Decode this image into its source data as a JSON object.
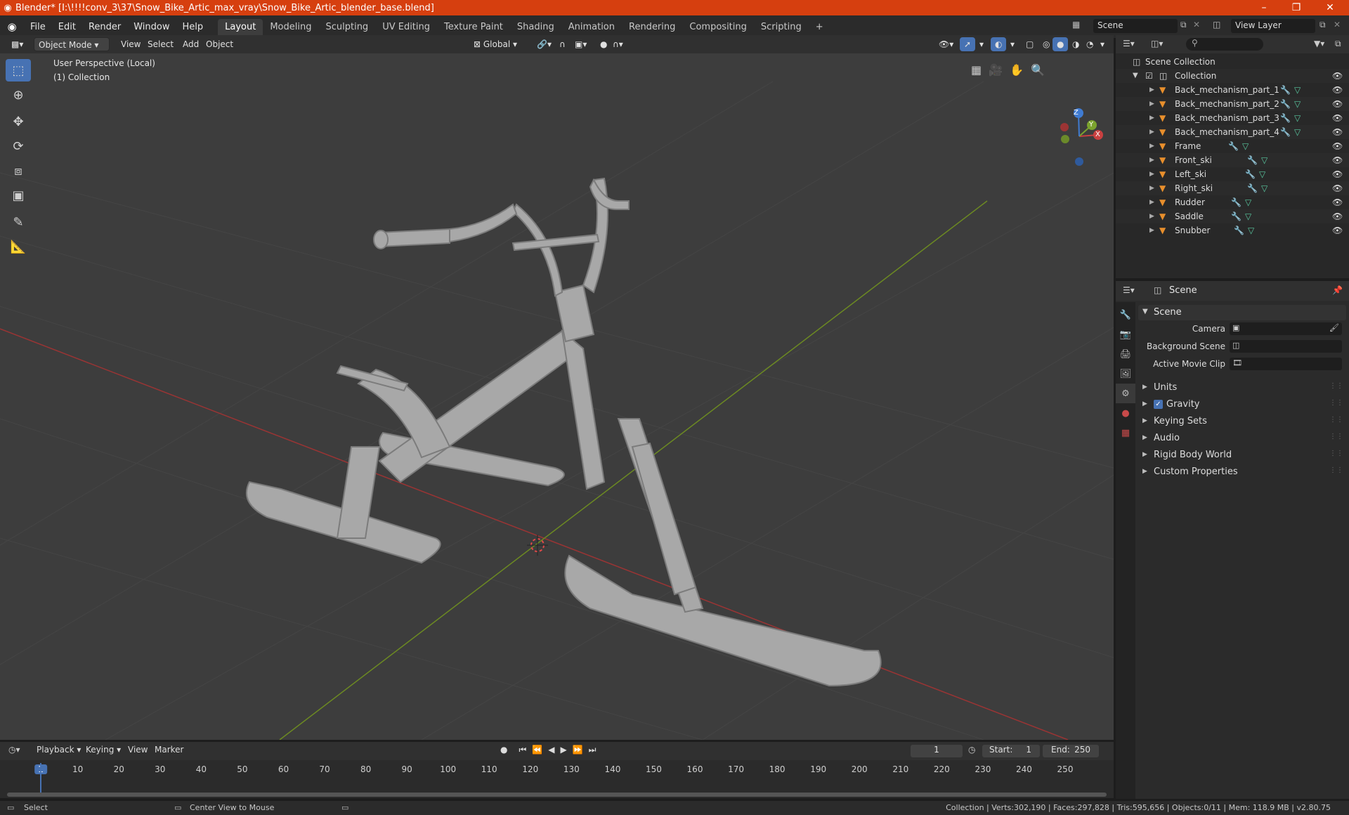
{
  "window": {
    "title": "Blender* [I:\\!!!!conv_3\\37\\Snow_Bike_Artic_max_vray\\Snow_Bike_Artic_blender_base.blend]",
    "minimize": "–",
    "restore": "❐",
    "close": "✕"
  },
  "menu": [
    "File",
    "Edit",
    "Render",
    "Window",
    "Help"
  ],
  "workspaces": [
    "Layout",
    "Modeling",
    "Sculpting",
    "UV Editing",
    "Texture Paint",
    "Shading",
    "Animation",
    "Rendering",
    "Compositing",
    "Scripting"
  ],
  "active_workspace": "Layout",
  "add_workspace": "+",
  "scene_field": "Scene",
  "view_layer_field": "View Layer",
  "viewport_header": {
    "mode": "Object Mode",
    "menus": [
      "View",
      "Select",
      "Add",
      "Object"
    ],
    "orientation": "Global"
  },
  "viewport": {
    "perspective": "User Perspective (Local)",
    "collection": "(1) Collection",
    "gizmo": {
      "x": "X",
      "y": "Y",
      "z": "Z"
    }
  },
  "outliner": {
    "search_placeholder": "",
    "root": "Scene Collection",
    "collection": "Collection",
    "objects": [
      "Back_mechanism_part_1",
      "Back_mechanism_part_2",
      "Back_mechanism_part_3",
      "Back_mechanism_part_4",
      "Frame",
      "Front_ski",
      "Left_ski",
      "Right_ski",
      "Rudder",
      "Saddle",
      "Snubber"
    ]
  },
  "properties": {
    "context": "Scene",
    "panel_title": "Scene",
    "camera_label": "Camera",
    "background_scene_label": "Background Scene",
    "active_movie_clip_label": "Active Movie Clip",
    "subpanels": [
      "Units",
      "Gravity",
      "Keying Sets",
      "Audio",
      "Rigid Body World",
      "Custom Properties"
    ],
    "gravity_checked": true
  },
  "timeline": {
    "menus": [
      "Playback",
      "Keying",
      "View",
      "Marker"
    ],
    "current_frame": "1",
    "start_label": "Start:",
    "start": "1",
    "end_label": "End:",
    "end": "250",
    "ticks": [
      "1",
      "10",
      "20",
      "30",
      "40",
      "50",
      "60",
      "70",
      "80",
      "90",
      "100",
      "110",
      "120",
      "130",
      "140",
      "150",
      "160",
      "170",
      "180",
      "190",
      "200",
      "210",
      "220",
      "230",
      "240",
      "250"
    ]
  },
  "statusbar": {
    "left": "Select",
    "middle": "Center View to Mouse",
    "right": "Collection | Verts:302,190 | Faces:297,828 | Tris:595,656 | Objects:0/11 | Mem: 118.9 MB | v2.80.75"
  },
  "colors": {
    "titlebar": "#d63f0f",
    "accent": "#4772b3",
    "mesh_icon": "#e88f2c",
    "modifier_icon": "#6e9ce6",
    "data_icon": "#59c8a0",
    "x_axis": "#c03a3a",
    "y_axis": "#7aa02a"
  }
}
